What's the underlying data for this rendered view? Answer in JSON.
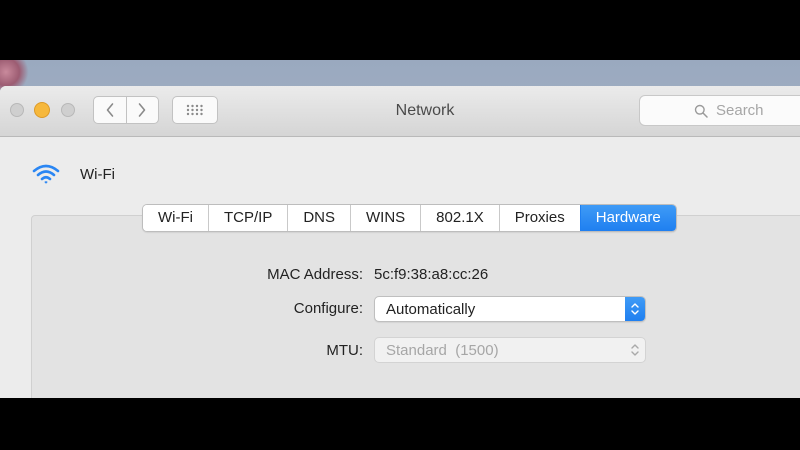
{
  "window": {
    "title": "Network",
    "search": {
      "placeholder": "Search"
    }
  },
  "service": {
    "name": "Wi-Fi",
    "icon": "wifi-icon"
  },
  "tabs": [
    {
      "label": "Wi-Fi",
      "active": false
    },
    {
      "label": "TCP/IP",
      "active": false
    },
    {
      "label": "DNS",
      "active": false
    },
    {
      "label": "WINS",
      "active": false
    },
    {
      "label": "802.1X",
      "active": false
    },
    {
      "label": "Proxies",
      "active": false
    },
    {
      "label": "Hardware",
      "active": true
    }
  ],
  "hardware": {
    "mac_label": "MAC Address:",
    "mac_value": "5c:f9:38:a8:cc:26",
    "configure_label": "Configure:",
    "configure_value": "Automatically",
    "mtu_label": "MTU:",
    "mtu_value": "Standard  (1500)",
    "mtu_enabled": false
  },
  "colors": {
    "accent": "#2a86f3",
    "minimize": "#f6b83c"
  }
}
